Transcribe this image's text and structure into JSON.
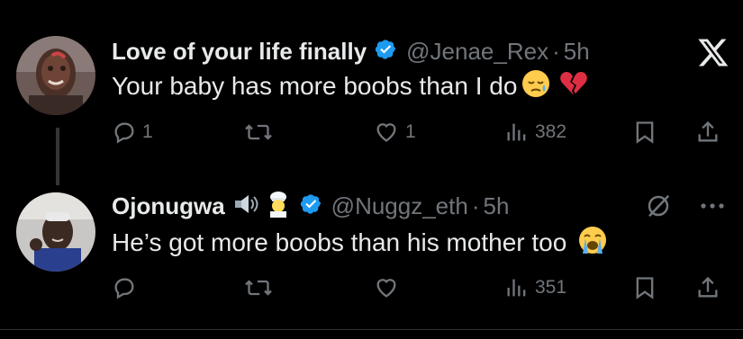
{
  "app": {
    "logo": "x-logo-icon"
  },
  "colors": {
    "background": "#000000",
    "text": "#e7e9ea",
    "muted": "#71767b",
    "verified": "#1d9bf0"
  },
  "tweets": [
    {
      "display_name": "Love of your life finally",
      "handle": "@Jenae_Rex",
      "sep": "·",
      "time": "5h",
      "text": "Your baby has more boobs than I do",
      "emojis": [
        "sad-relieved-face-emoji",
        "broken-heart-emoji"
      ],
      "replies": "1",
      "reposts": "",
      "likes": "1",
      "views": "382"
    },
    {
      "display_name": "Ojonugwa",
      "name_emojis": [
        "speaker-emoji",
        "cook-emoji"
      ],
      "handle": "@Nuggz_eth",
      "sep": "·",
      "time": "5h",
      "text": "He’s got more boobs than his mother too",
      "emojis": [
        "loudly-crying-face-emoji"
      ],
      "replies": "",
      "reposts": "",
      "likes": "",
      "views": "351"
    }
  ]
}
